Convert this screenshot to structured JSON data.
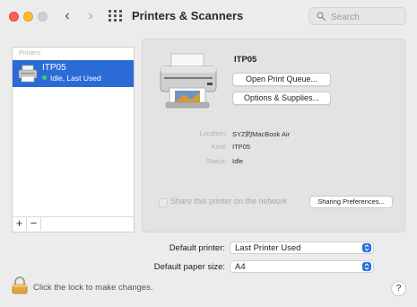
{
  "window": {
    "title": "Printers & Scanners",
    "search_placeholder": "Search"
  },
  "sidebar": {
    "header": "Printers",
    "printers": [
      {
        "name": "ITP05",
        "status": "Idle, Last Used",
        "status_color": "#3fd05a"
      }
    ],
    "add_label": "+",
    "remove_label": "−"
  },
  "detail": {
    "printer_name": "ITP05",
    "open_queue_label": "Open Print Queue...",
    "options_label": "Options & Supplies...",
    "location_label": "Location:",
    "location_value": "SYZ的MacBook Air",
    "kind_label": "Kind:",
    "kind_value": "ITP05",
    "status_label": "Status:",
    "status_value": "Idle",
    "share_label": "Share this printer on the network",
    "share_checked": false,
    "sharing_prefs_label": "Sharing Preferences..."
  },
  "defaults": {
    "printer_label": "Default printer:",
    "printer_value": "Last Printer Used",
    "paper_label": "Default paper size:",
    "paper_value": "A4"
  },
  "footer": {
    "lock_text": "Click the lock to make changes.",
    "help_label": "?"
  },
  "colors": {
    "selection": "#2c6bd6",
    "accent": "#2a6ee0"
  }
}
